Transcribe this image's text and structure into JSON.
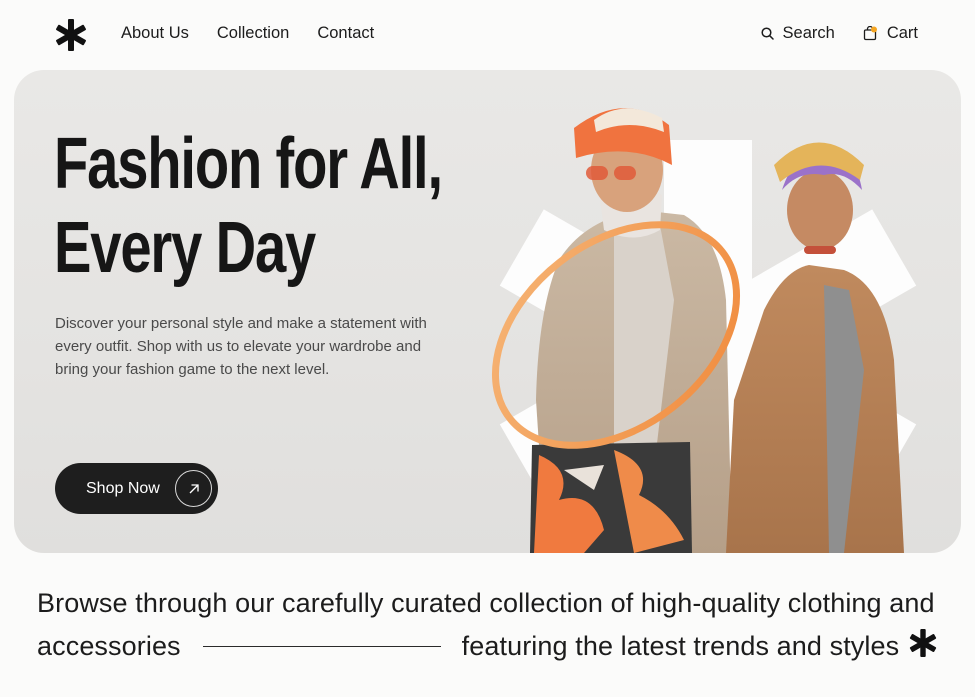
{
  "nav": {
    "links": [
      "About Us",
      "Collection",
      "Contact"
    ],
    "search_label": "Search",
    "cart_label": "Cart",
    "logo_icon": "asterisk-icon",
    "search_icon": "search-icon",
    "cart_icon": "shopping-bag-icon"
  },
  "hero": {
    "title_line1": "Fashion for All,",
    "title_line2": "Every Day",
    "description": "Discover your personal style and make a statement with every outfit. Shop with us to elevate your wardrobe and bring your fashion game to the next level.",
    "cta_label": "Shop Now",
    "cta_icon": "arrow-up-right-icon"
  },
  "tagline": {
    "part1": "Browse through our carefully curated collection of high-quality clothing and",
    "part2": "accessories",
    "part3": "featuring the latest trends and styles",
    "star_icon": "asterisk-icon"
  },
  "colors": {
    "accent_orange": "#f0733f",
    "cart_dot": "#f5a623",
    "button_bg": "#1e1e1e",
    "hero_bg": "#e6e5e3"
  }
}
